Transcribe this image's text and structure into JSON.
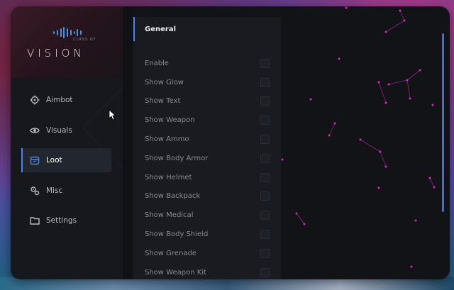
{
  "brand": {
    "logo_text": "VISION",
    "logo_sub": "CLASS OF"
  },
  "nav": {
    "items": [
      {
        "label": "Aimbot",
        "icon": "crosshair-icon"
      },
      {
        "label": "Visuals",
        "icon": "eye-icon"
      },
      {
        "label": "Loot",
        "icon": "box-icon",
        "active": true
      },
      {
        "label": "Misc",
        "icon": "gears-icon"
      },
      {
        "label": "Settings",
        "icon": "folder-icon"
      }
    ]
  },
  "panel": {
    "title": "General",
    "options": [
      "Enable",
      "Show Glow",
      "Show Text",
      "Show Weapon",
      "Show Ammo",
      "Show Body Armor",
      "Show Helmet",
      "Show Backpack",
      "Show Medical",
      "Show Body Shield",
      "Show Grenade",
      "Show Weapon Kit"
    ]
  },
  "colors": {
    "accent": "#4b84e6",
    "dots": "#d926c8",
    "background": "#121317"
  }
}
